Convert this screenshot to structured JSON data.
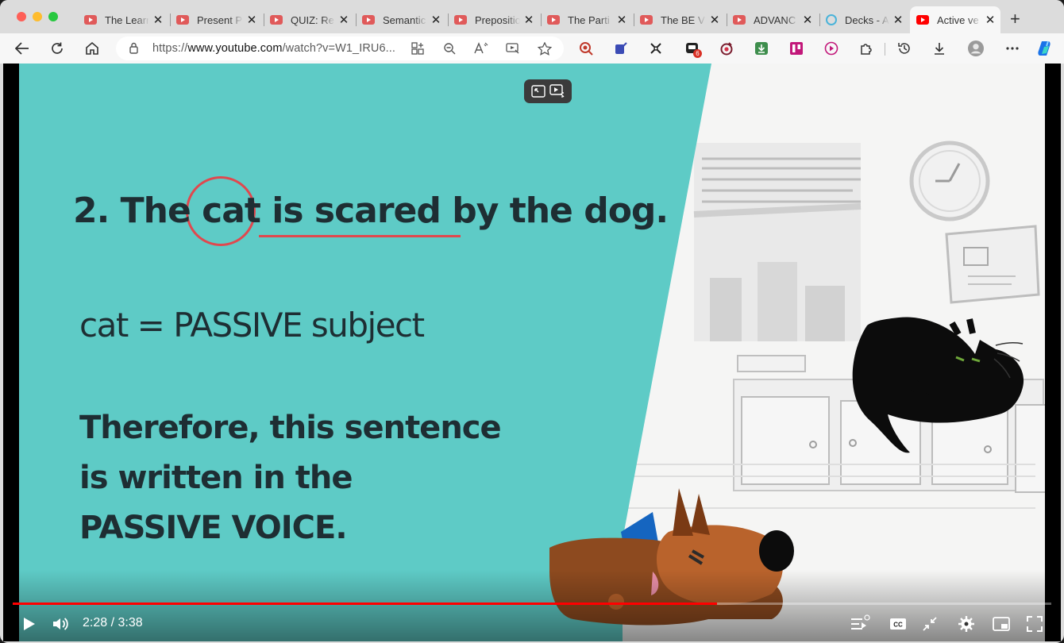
{
  "browser": {
    "tabs": [
      {
        "label": "The Learn",
        "icon": "youtube-icon"
      },
      {
        "label": "Present P",
        "icon": "youtube-icon"
      },
      {
        "label": "QUIZ: Re",
        "icon": "youtube-icon"
      },
      {
        "label": "Semantic",
        "icon": "youtube-icon"
      },
      {
        "label": "Prepositio",
        "icon": "youtube-icon"
      },
      {
        "label": "The Parti",
        "icon": "youtube-icon"
      },
      {
        "label": "The BE V",
        "icon": "youtube-icon"
      },
      {
        "label": "ADVANC",
        "icon": "youtube-icon"
      },
      {
        "label": "Decks - A",
        "icon": "decks-icon"
      },
      {
        "label": "Active ve",
        "icon": "youtube-icon",
        "active": true
      }
    ],
    "url_prefix": "https://",
    "url_host": "www.youtube.com",
    "url_path": "/watch?v=W1_IRU6...",
    "notification_badge": "6",
    "accent": "#ff0000"
  },
  "video": {
    "sentence": "2. The cat is scared by the dog.",
    "sentence_parts": {
      "prefix": "2. The ",
      "subject": "cat",
      "rest": " is scared by the dog."
    },
    "subject_line": "cat = PASSIVE subject",
    "conclusion_lines": [
      "Therefore, this sentence",
      "is written in the",
      "PASSIVE VOICE."
    ],
    "teal_color": "#5ecbc6",
    "highlight_color": "#e0484e"
  },
  "player": {
    "current_time": "2:28",
    "duration": "3:38",
    "time_display": "2:28 / 3:38",
    "progress_fraction": 0.678
  }
}
